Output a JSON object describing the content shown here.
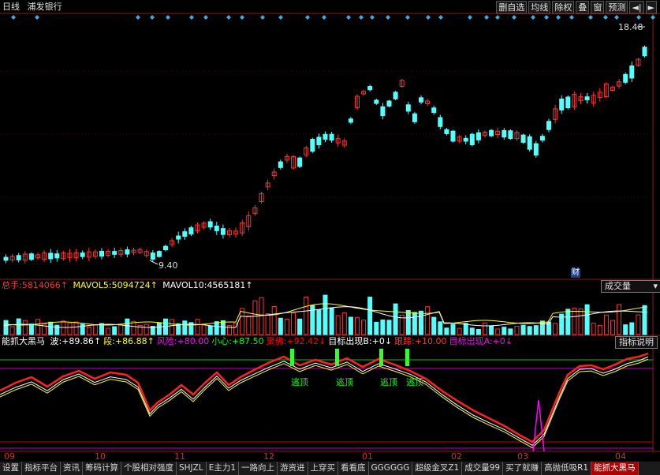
{
  "header": {
    "period": "日线",
    "stock_name": "浦发银行"
  },
  "toolbar": {
    "buttons": [
      "删自选",
      "均线",
      "除权",
      "叠",
      "窗",
      "预测",
      "◄|",
      "►"
    ]
  },
  "price_panel": {
    "high_label": "18.48",
    "low_label": "9.40",
    "fin_marker": "财"
  },
  "volume_panel": {
    "label_total": "总手:",
    "total_value": "5814066↑",
    "label_mavol5": "MAVOL5:",
    "mavol5_value": "5094724↑",
    "label_mavol10": "MAVOL10:",
    "mavol10_value": "4565181↑",
    "select_label": "成交量"
  },
  "indicator_panel": {
    "name": "能抓大黑马",
    "items": [
      {
        "label": "波:",
        "value": "+89.86↑",
        "color": "#ffffff"
      },
      {
        "label": "段:",
        "value": "+86.88↑",
        "color": "#ffff00"
      },
      {
        "label": "风险:",
        "value": "+80.00",
        "color": "#ff00ff"
      },
      {
        "label": "小心:",
        "value": "+87.50",
        "color": "#00ff00"
      },
      {
        "label": "聚佛:",
        "value": "+92.42↓",
        "color": "#ff0000"
      },
      {
        "label": "目标出现B:",
        "value": "+0↓",
        "color": "#ffffff"
      },
      {
        "label": "跟踪:",
        "value": "+10.00",
        "color": "#ff3333"
      },
      {
        "label": "目标出现A:",
        "value": "+0↓",
        "color": "#ff00ff"
      }
    ],
    "help_button": "指标说明",
    "signal_label": "逃顶"
  },
  "date_axis": [
    "09",
    "10",
    "11",
    "12",
    "01",
    "02",
    "03",
    "04"
  ],
  "tabs": [
    "设置",
    "指标平台",
    "资讯",
    "筹码计算",
    "个股相对强度",
    "SHJZL",
    "E主力1",
    "一路向上",
    "游资进",
    "上穿买",
    "看看底",
    "GGGGGG",
    "超级金叉Z1",
    "成交量99",
    "买了就赚",
    "高抛低吸R1",
    "能抓大黑马"
  ],
  "active_tab": "能抓大黑马",
  "colors": {
    "up": "#ff3232",
    "down": "#54ffff",
    "panel_border": "#8b1a1a",
    "diamond": "#4aa8d8"
  }
}
